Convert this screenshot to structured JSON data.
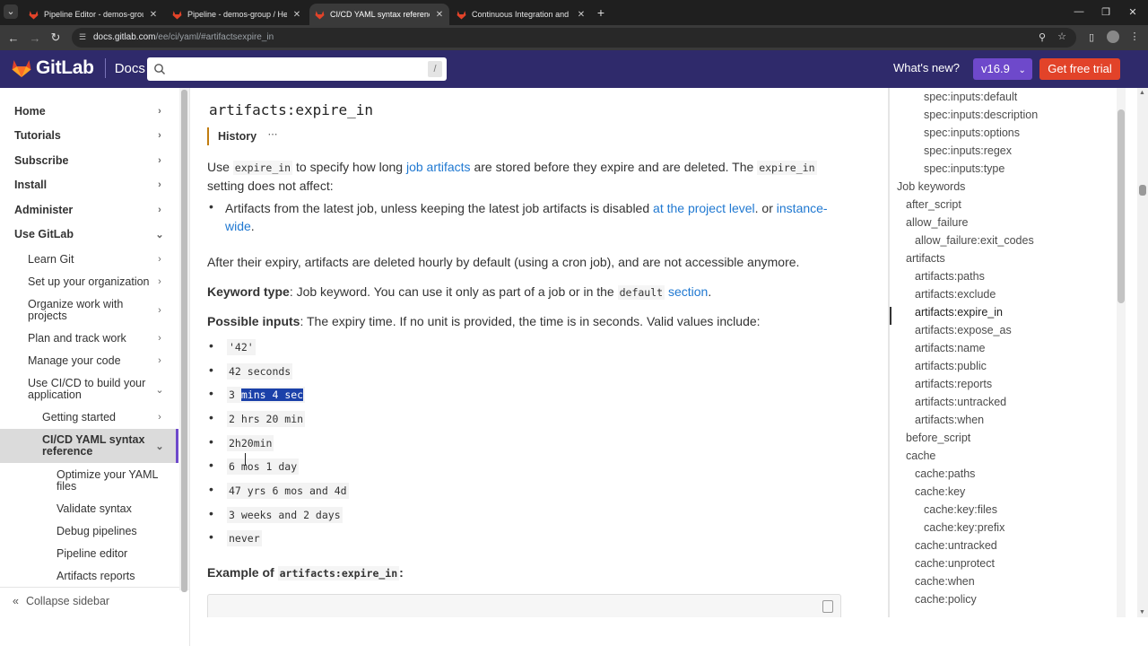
{
  "browser": {
    "tabs": [
      {
        "title": "Pipeline Editor - demos-group /",
        "favicon_color": "#e24329"
      },
      {
        "title": "Pipeline - demos-group / Hello",
        "favicon_color": "#e24329"
      },
      {
        "title": "CI/CD YAML syntax reference |",
        "favicon_color": "#e24329"
      },
      {
        "title": "Continuous Integration and De",
        "favicon_color": "#e24329"
      }
    ],
    "new_tab": "+",
    "url_host": "docs.gitlab.com",
    "url_path": "/ee/ci/yaml/#artifactsexpire_in"
  },
  "header": {
    "brand": "GitLab",
    "product": "Docs",
    "search_shortcut": "/",
    "whats_new": "What's new?",
    "version": "v16.9",
    "cta": "Get free trial"
  },
  "leftnav": {
    "items": [
      {
        "label": "Home",
        "chev": "›"
      },
      {
        "label": "Tutorials",
        "chev": "›"
      },
      {
        "label": "Subscribe",
        "chev": "›"
      },
      {
        "label": "Install",
        "chev": "›"
      },
      {
        "label": "Administer",
        "chev": "›"
      },
      {
        "label": "Use GitLab",
        "chev": "⌄"
      },
      {
        "label": "Learn Git",
        "chev": "›"
      },
      {
        "label": "Set up your organization",
        "chev": "›"
      },
      {
        "label": "Organize work with projects",
        "chev": "›"
      },
      {
        "label": "Plan and track work",
        "chev": "›"
      },
      {
        "label": "Manage your code",
        "chev": "›"
      },
      {
        "label": "Use CI/CD to build your application",
        "chev": "⌄"
      },
      {
        "label": "Getting started",
        "chev": "›"
      },
      {
        "label": "CI/CD YAML syntax reference",
        "chev": "⌄"
      },
      {
        "label": "Optimize your YAML files",
        "chev": ""
      },
      {
        "label": "Validate syntax",
        "chev": ""
      },
      {
        "label": "Debug pipelines",
        "chev": ""
      },
      {
        "label": "Pipeline editor",
        "chev": ""
      },
      {
        "label": "Artifacts reports",
        "chev": ""
      }
    ],
    "collapse": "Collapse sidebar"
  },
  "main": {
    "title": "artifacts:expire_in",
    "history": "History",
    "history_more": "⋯",
    "p1": {
      "a": "Use ",
      "code1": "expire_in",
      "b": " to specify how long ",
      "link": "job artifacts",
      "c": " are stored before they expire and are deleted. The ",
      "code2": "expire_in",
      "d": "setting does not affect:"
    },
    "bullet1": {
      "a": "Artifacts from the latest job, unless keeping the latest job artifacts is disabled ",
      "link1": "at the project level",
      "b": ". or ",
      "link2a": "instance-",
      "link2b": "wide",
      "c": "."
    },
    "p2": "After their expiry, artifacts are deleted hourly by default (using a cron job), and are not accessible anymore.",
    "keyword_type": {
      "label": "Keyword type",
      "a": ": Job keyword. You can use it only as part of a job or in the ",
      "code": "default",
      "link": "section",
      "b": "."
    },
    "possible_inputs": {
      "label": "Possible inputs",
      "text": ": The expiry time. If no unit is provided, the time is in seconds. Valid values include:"
    },
    "values": [
      "'42'",
      "42 seconds",
      "3 mins 4 sec",
      "2 hrs 20 min",
      "2h20min",
      "6 mos 1 day",
      "47 yrs 6 mos and 4d",
      "3 weeks and 2 days",
      "never"
    ],
    "selected_prefix": "3 ",
    "selected_text": "mins 4 sec",
    "example": {
      "label": "Example of ",
      "code": "artifacts:expire_in",
      "colon": ":"
    }
  },
  "toc": {
    "items": [
      {
        "label": "spec:inputs:default",
        "level": 3
      },
      {
        "label": "spec:inputs:description",
        "level": 3
      },
      {
        "label": "spec:inputs:options",
        "level": 3
      },
      {
        "label": "spec:inputs:regex",
        "level": 3
      },
      {
        "label": "spec:inputs:type",
        "level": 3
      },
      {
        "label": "Job keywords",
        "level": 0
      },
      {
        "label": "after_script",
        "level": 1
      },
      {
        "label": "allow_failure",
        "level": 1
      },
      {
        "label": "allow_failure:exit_codes",
        "level": 2
      },
      {
        "label": "artifacts",
        "level": 1
      },
      {
        "label": "artifacts:paths",
        "level": 2
      },
      {
        "label": "artifacts:exclude",
        "level": 2
      },
      {
        "label": "artifacts:expire_in",
        "level": 2
      },
      {
        "label": "artifacts:expose_as",
        "level": 2
      },
      {
        "label": "artifacts:name",
        "level": 2
      },
      {
        "label": "artifacts:public",
        "level": 2
      },
      {
        "label": "artifacts:reports",
        "level": 2
      },
      {
        "label": "artifacts:untracked",
        "level": 2
      },
      {
        "label": "artifacts:when",
        "level": 2
      },
      {
        "label": "before_script",
        "level": 1
      },
      {
        "label": "cache",
        "level": 1
      },
      {
        "label": "cache:paths",
        "level": 2
      },
      {
        "label": "cache:key",
        "level": 2
      },
      {
        "label": "cache:key:files",
        "level": 3
      },
      {
        "label": "cache:key:prefix",
        "level": 3
      },
      {
        "label": "cache:untracked",
        "level": 2
      },
      {
        "label": "cache:unprotect",
        "level": 2
      },
      {
        "label": "cache:when",
        "level": 2
      },
      {
        "label": "cache:policy",
        "level": 2
      }
    ],
    "active_index": 12
  },
  "colors": {
    "header_bg": "#2f2a6b",
    "accent_purple": "#6e49cb",
    "brand_orange": "#e24329",
    "link_blue": "#1f78d1",
    "selection": "#1b41a9"
  }
}
